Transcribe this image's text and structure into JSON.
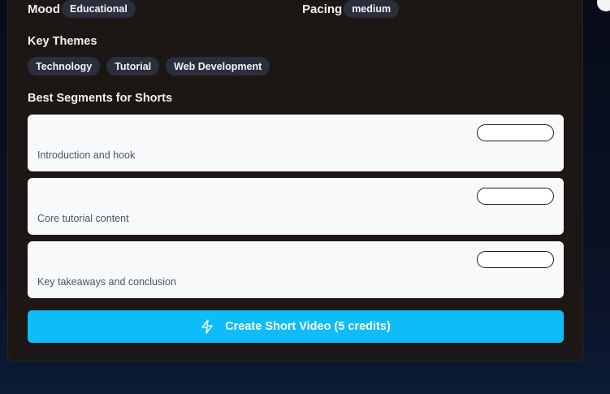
{
  "mood": {
    "label": "Mood",
    "value": "Educational"
  },
  "pacing": {
    "label": "Pacing",
    "value": "medium"
  },
  "key_themes": {
    "title": "Key Themes",
    "items": [
      "Technology",
      "Tutorial",
      "Web Development"
    ]
  },
  "segments": {
    "title": "Best Segments for Shorts",
    "items": [
      {
        "description": "Introduction and hook"
      },
      {
        "description": "Core tutorial content"
      },
      {
        "description": "Key takeaways and conclusion"
      }
    ]
  },
  "cta": {
    "label": "Create Short Video (5 credits)",
    "icon": "zap-icon"
  },
  "colors": {
    "card_bg": "#1c1715",
    "accent": "#0ebcf7",
    "pill_bg": "#2a2f3b"
  }
}
